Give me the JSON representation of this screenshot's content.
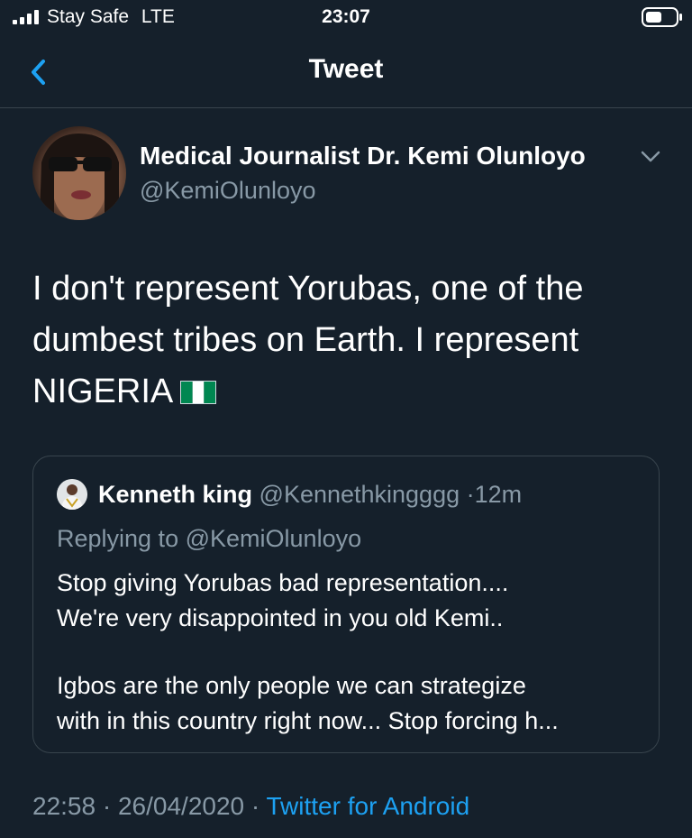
{
  "status_bar": {
    "carrier": "Stay Safe",
    "network": "LTE",
    "time": "23:07",
    "battery_level": 0.55
  },
  "header": {
    "title": "Tweet",
    "back_icon": "chevron-left-icon"
  },
  "tweet": {
    "author": {
      "display_name": "Medical Journalist Dr. Kemi Olunloyo",
      "handle": "@KemiOlunloyo"
    },
    "text_line1": "I don't represent Yorubas, one of the",
    "text_line2": "dumbest tribes on Earth. I represent",
    "text_line3": "NIGERIA",
    "flag_icon": "nigeria-flag-icon",
    "timestamp": "22:58",
    "date": "26/04/2020",
    "separator": "·",
    "source": "Twitter for Android"
  },
  "quote": {
    "display_name": "Kenneth king",
    "handle": "@Kennethkingggg",
    "separator": "·",
    "age": "12m",
    "replying_to_label": "Replying to",
    "replying_to_handle": "@KemiOlunloyo",
    "line1": "Stop giving Yorubas bad representation....",
    "line2": "We're very disappointed in you old Kemi..",
    "line3": "Igbos are the only people we can strategize",
    "line4": "with in this country right now... Stop forcing h..."
  },
  "colors": {
    "background": "#15202b",
    "secondary_text": "#8899a6",
    "accent": "#1da1f2",
    "border": "#38444d",
    "flag_green": "#008751"
  }
}
